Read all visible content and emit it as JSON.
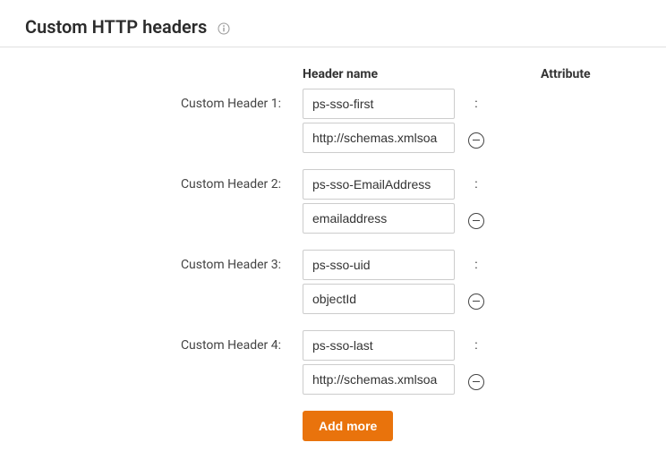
{
  "section": {
    "title": "Custom HTTP headers"
  },
  "columns": {
    "header_name": "Header name",
    "attribute": "Attribute"
  },
  "rows": [
    {
      "label": "Custom Header 1:",
      "name": "ps-sso-first",
      "attr": "http://schemas.xmlsoa"
    },
    {
      "label": "Custom Header 2:",
      "name": "ps-sso-EmailAddress",
      "attr": "emailaddress"
    },
    {
      "label": "Custom Header 3:",
      "name": "ps-sso-uid",
      "attr": "objectId"
    },
    {
      "label": "Custom Header 4:",
      "name": "ps-sso-last",
      "attr": "http://schemas.xmlsoa"
    }
  ],
  "buttons": {
    "add_more": "Add more"
  }
}
